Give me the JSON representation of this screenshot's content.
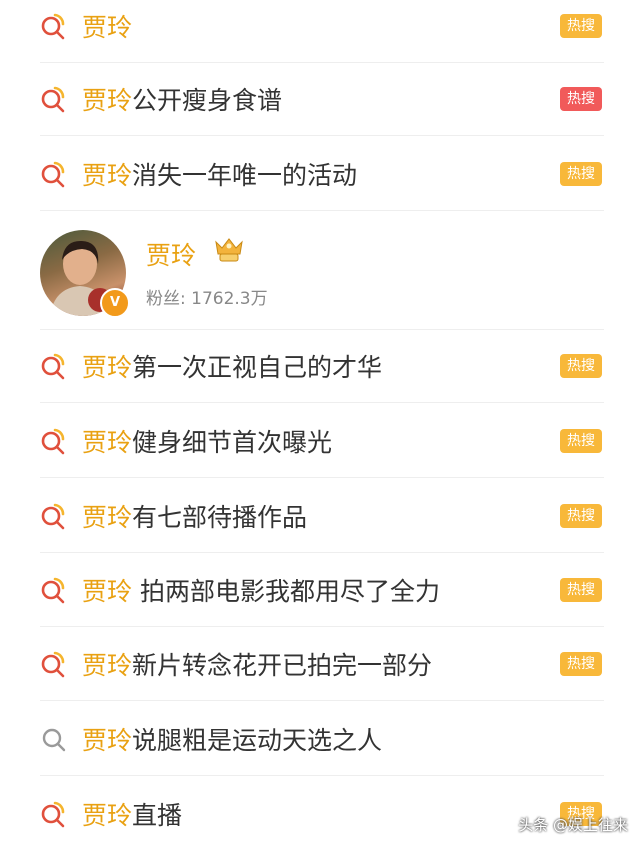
{
  "keyword": "贾玲",
  "hot_items_top": [
    {
      "rest": "",
      "badge": "热搜",
      "badge_color": "#f8b83a"
    },
    {
      "rest": "公开瘦身食谱",
      "badge": "热搜",
      "badge_color": "#f15a5a"
    },
    {
      "rest": "消失一年唯一的活动",
      "badge": "热搜",
      "badge_color": "#f8b83a"
    }
  ],
  "user_card": {
    "name": "贾玲",
    "verified_badge": "V",
    "fans": "粉丝: 1762.3万"
  },
  "hot_items_bottom": [
    {
      "rest": "第一次正视自己的才华",
      "badge": "热搜"
    },
    {
      "rest": "健身细节首次曝光",
      "badge": "热搜"
    },
    {
      "rest": "有七部待播作品",
      "badge": "热搜"
    },
    {
      "rest": " 拍两部电影我都用尽了全力",
      "badge": "热搜"
    },
    {
      "rest": "新片转念花开已拍完一部分",
      "badge": "热搜"
    },
    {
      "rest": "说腿粗是运动天选之人",
      "badge": ""
    },
    {
      "rest": "直播",
      "badge": "热搜"
    }
  ],
  "watermark": "头条 @娱上往来",
  "colors": {
    "keyword": "#e9a112",
    "badge_orange": "#f8b83a",
    "badge_red": "#f15a5a"
  }
}
